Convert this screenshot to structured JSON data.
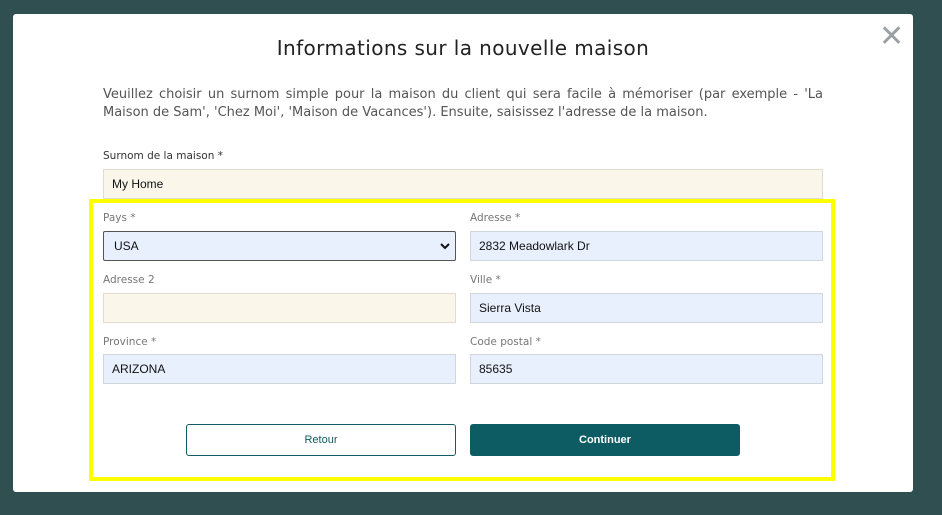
{
  "modal": {
    "title": "Informations sur la nouvelle maison",
    "intro": "Veuillez choisir un surnom simple pour la maison du client qui sera facile à mémoriser (par exemple - 'La Maison de Sam', 'Chez Moi', 'Maison de Vacances'). Ensuite, saisissez l'adresse de la maison.",
    "close_icon": "close-icon"
  },
  "form": {
    "nickname": {
      "label": "Surnom de la maison *",
      "value": "My Home"
    },
    "country": {
      "label": "Pays *",
      "value": "USA"
    },
    "address": {
      "label": "Adresse *",
      "value": "2832 Meadowlark Dr"
    },
    "address2": {
      "label": "Adresse 2",
      "value": ""
    },
    "city": {
      "label": "Ville *",
      "value": "Sierra Vista"
    },
    "province": {
      "label": "Province *",
      "value": "ARIZONA"
    },
    "postal_code": {
      "label": "Code postal *",
      "value": "85635"
    }
  },
  "buttons": {
    "back": "Retour",
    "continue": "Continuer"
  },
  "colors": {
    "backdrop": "#2f4f51",
    "accent": "#0d5c63",
    "highlight": "#ffff00",
    "autofill": "#e8f0fe",
    "beige": "#faf6ea"
  }
}
